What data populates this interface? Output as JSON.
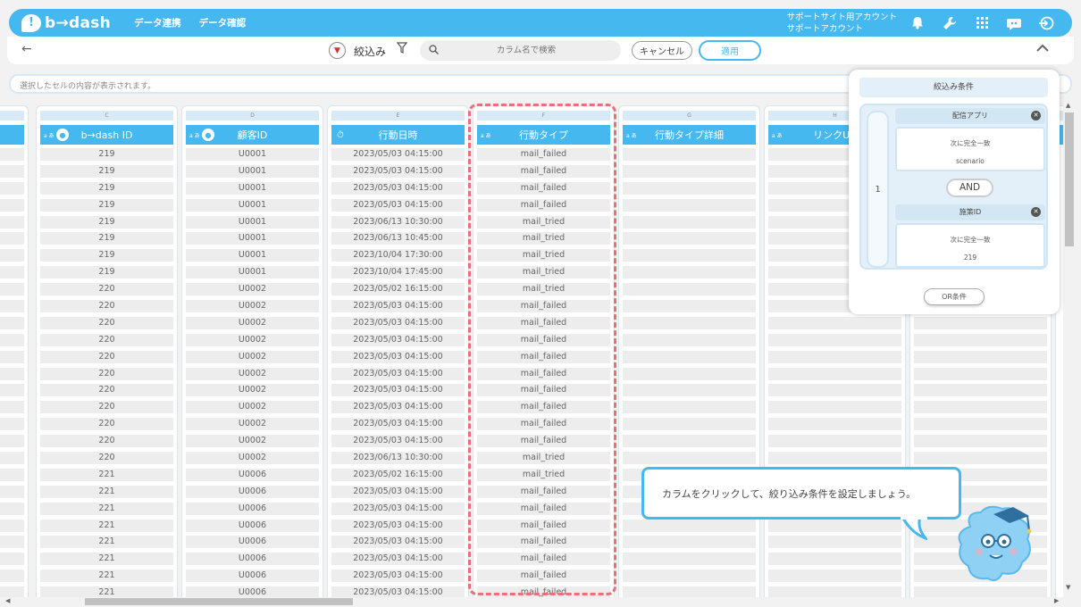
{
  "app": {
    "logo_text": "b→dash",
    "menu": [
      "データ連携",
      "データ確認"
    ],
    "account_line1": "サポートサイト用アカウント",
    "account_line2": "サポートアカウント",
    "icons": [
      "bell-icon",
      "wrench-icon",
      "grid-icon",
      "chat-bot-icon",
      "logout-icon"
    ],
    "brand_color": "#45b8f0"
  },
  "toolbar": {
    "back": "←",
    "filter_label": "絞込み",
    "search_placeholder": "カラム名で検索",
    "cancel_label": "キャンセル",
    "apply_label": "適用",
    "collapse": "⌃"
  },
  "cellbar": {
    "placeholder": "選択したセルの内容が表示されます。"
  },
  "columns": [
    {
      "letter": "C",
      "header": "b→dash ID"
    },
    {
      "letter": "D",
      "header": "顧客ID"
    },
    {
      "letter": "E",
      "header": "行動日時"
    },
    {
      "letter": "F",
      "header": "行動タイプ"
    },
    {
      "letter": "G",
      "header": "行動タイプ詳細"
    },
    {
      "letter": "H",
      "header": "リンクUR"
    }
  ],
  "type_badge": "a あ",
  "rows": [
    [
      "219",
      "U0001",
      "2023/05/03 04:15:00",
      "mail_failed"
    ],
    [
      "219",
      "U0001",
      "2023/05/03 04:15:00",
      "mail_failed"
    ],
    [
      "219",
      "U0001",
      "2023/05/03 04:15:00",
      "mail_failed"
    ],
    [
      "219",
      "U0001",
      "2023/05/03 04:15:00",
      "mail_failed"
    ],
    [
      "219",
      "U0001",
      "2023/06/13 10:30:00",
      "mail_tried"
    ],
    [
      "219",
      "U0001",
      "2023/06/13 10:45:00",
      "mail_tried"
    ],
    [
      "219",
      "U0001",
      "2023/10/04 17:30:00",
      "mail_tried"
    ],
    [
      "219",
      "U0001",
      "2023/10/04 17:45:00",
      "mail_tried"
    ],
    [
      "220",
      "U0002",
      "2023/05/02 16:15:00",
      "mail_tried"
    ],
    [
      "220",
      "U0002",
      "2023/05/03 04:15:00",
      "mail_failed"
    ],
    [
      "220",
      "U0002",
      "2023/05/03 04:15:00",
      "mail_failed"
    ],
    [
      "220",
      "U0002",
      "2023/05/03 04:15:00",
      "mail_failed"
    ],
    [
      "220",
      "U0002",
      "2023/05/03 04:15:00",
      "mail_failed"
    ],
    [
      "220",
      "U0002",
      "2023/05/03 04:15:00",
      "mail_failed"
    ],
    [
      "220",
      "U0002",
      "2023/05/03 04:15:00",
      "mail_failed"
    ],
    [
      "220",
      "U0002",
      "2023/05/03 04:15:00",
      "mail_failed"
    ],
    [
      "220",
      "U0002",
      "2023/05/03 04:15:00",
      "mail_failed"
    ],
    [
      "220",
      "U0002",
      "2023/05/03 04:15:00",
      "mail_failed"
    ],
    [
      "220",
      "U0002",
      "2023/06/13 10:30:00",
      "mail_tried"
    ],
    [
      "221",
      "U0006",
      "2023/05/02 16:15:00",
      "mail_tried"
    ],
    [
      "221",
      "U0006",
      "2023/05/03 04:15:00",
      "mail_failed"
    ],
    [
      "221",
      "U0006",
      "2023/05/03 04:15:00",
      "mail_failed"
    ],
    [
      "221",
      "U0006",
      "2023/05/03 04:15:00",
      "mail_failed"
    ],
    [
      "221",
      "U0006",
      "2023/05/03 04:15:00",
      "mail_failed"
    ],
    [
      "221",
      "U0006",
      "2023/05/03 04:15:00",
      "mail_failed"
    ],
    [
      "221",
      "U0006",
      "2023/05/03 04:15:00",
      "mail_failed"
    ],
    [
      "221",
      "U0006",
      "2023/05/03 04:15:00",
      "mail_failed"
    ]
  ],
  "panel": {
    "title": "絞込み条件",
    "group_number": "1",
    "conditions": [
      {
        "column": "配信アプリ",
        "operator": "次に完全一致",
        "value": "scenario"
      },
      {
        "column": "施策ID",
        "operator": "次に完全一致",
        "value": "219"
      }
    ],
    "and_label": "AND",
    "or_label": "OR条件"
  },
  "tooltip": {
    "text": "カラムをクリックして、絞り込み条件を設定しましょう。"
  },
  "highlight_color": "#e8707a"
}
